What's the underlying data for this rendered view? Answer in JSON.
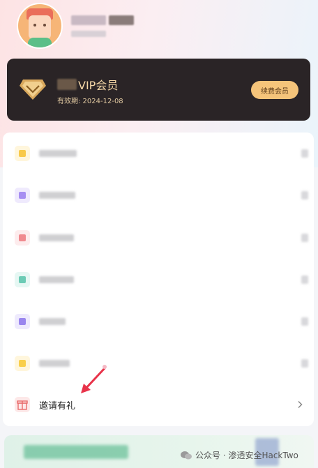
{
  "vip": {
    "name": "VIP会员",
    "expiry": "有效期: 2024-12-08",
    "renew_label": "续费会员"
  },
  "menu": {
    "items": [
      {
        "icon": "document-icon",
        "color": "#f8c94a",
        "bg": "#fff6dc"
      },
      {
        "icon": "grid-icon",
        "color": "#a68ef2",
        "bg": "#efeafd"
      },
      {
        "icon": "heart-icon",
        "color": "#f08a8f",
        "bg": "#fdeced"
      },
      {
        "icon": "leaf-icon",
        "color": "#6ccbb5",
        "bg": "#e6f7f3"
      },
      {
        "icon": "box-icon",
        "color": "#9a86ee",
        "bg": "#eeeafd"
      },
      {
        "icon": "star-icon",
        "color": "#f9cf4b",
        "bg": "#fff6dc"
      }
    ],
    "invite_label": "邀请有礼"
  },
  "watermark": {
    "text": "公众号 · 渗透安全HackTwo"
  },
  "colors": {
    "vip_card": "#2a2426",
    "vip_gold": "#f3d6a6",
    "renew_button": "#f5c47a",
    "arrow": "#e8334a"
  }
}
